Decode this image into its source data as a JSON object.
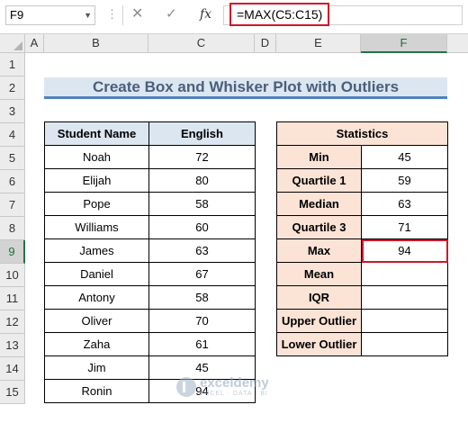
{
  "formula_bar": {
    "name_box": "F9",
    "cancel_glyph": "✕",
    "enter_glyph": "✓",
    "fx_label": "fx",
    "formula": "=MAX(C5:C15)"
  },
  "columns": [
    "A",
    "B",
    "C",
    "D",
    "E",
    "F"
  ],
  "rows": [
    "1",
    "2",
    "3",
    "4",
    "5",
    "6",
    "7",
    "8",
    "9",
    "10",
    "11",
    "12",
    "13",
    "14",
    "15"
  ],
  "active_cell": {
    "column": "F",
    "row": "9"
  },
  "title": "Create Box and Whisker Plot with Outliers",
  "student_table": {
    "headers": {
      "name": "Student Name",
      "english": "English"
    },
    "rows": [
      {
        "name": "Noah",
        "english": "72"
      },
      {
        "name": "Elijah",
        "english": "80"
      },
      {
        "name": "Pope",
        "english": "58"
      },
      {
        "name": "Williams",
        "english": "60"
      },
      {
        "name": "James",
        "english": "63"
      },
      {
        "name": "Daniel",
        "english": "67"
      },
      {
        "name": "Antony",
        "english": "58"
      },
      {
        "name": "Oliver",
        "english": "70"
      },
      {
        "name": "Zaha",
        "english": "61"
      },
      {
        "name": "Jim",
        "english": "45"
      },
      {
        "name": "Ronin",
        "english": "94"
      }
    ]
  },
  "stats_table": {
    "header": "Statistics",
    "rows": [
      {
        "label": "Min",
        "value": "45"
      },
      {
        "label": "Quartile 1",
        "value": "59"
      },
      {
        "label": "Median",
        "value": "63"
      },
      {
        "label": "Quartile 3",
        "value": "71"
      },
      {
        "label": "Max",
        "value": "94"
      },
      {
        "label": "Mean",
        "value": ""
      },
      {
        "label": "IQR",
        "value": ""
      },
      {
        "label": "Upper Outlier",
        "value": ""
      },
      {
        "label": "Lower Outlier",
        "value": ""
      }
    ]
  },
  "watermark": {
    "name": "exceldemy",
    "tagline": "EXCEL · DATA · BI"
  },
  "colors": {
    "accent_red": "#d0152a",
    "excel_green": "#217346",
    "title_fill": "#dce6f1",
    "title_border": "#4f81bd",
    "stats_fill": "#fbe3d6"
  }
}
